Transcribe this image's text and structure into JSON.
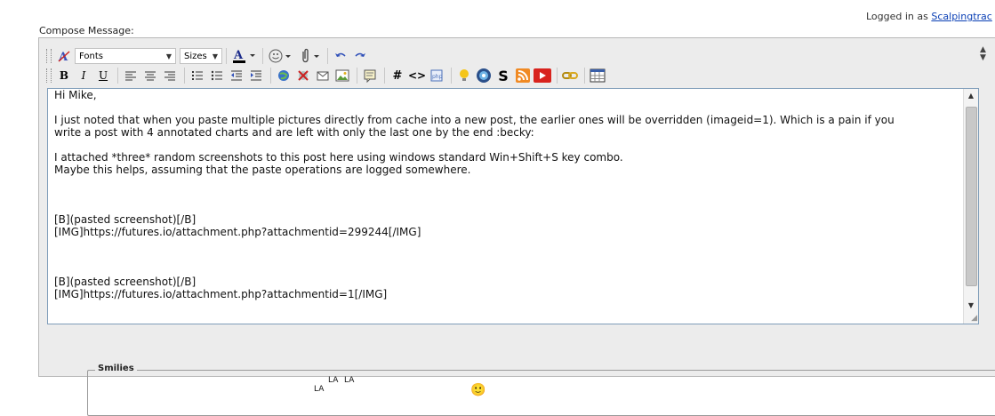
{
  "header": {
    "logged_in_prefix": "Logged in as",
    "username": "Scalpingtrac"
  },
  "compose": {
    "label": "Compose Message:"
  },
  "toolbar": {
    "font_select": "Fonts",
    "size_select": "Sizes",
    "bold": "B",
    "italic": "I",
    "underline": "U"
  },
  "editor": {
    "lines": [
      "Hi Mike,",
      "",
      "I just noted that when you paste multiple pictures directly from cache into a new post, the earlier ones will be overridden (imageid=1). Which is a pain if you",
      "write a post with 4 annotated charts and are left with only the last one by the end :becky:",
      "",
      "I attached *three* random screenshots to this post here using windows standard Win+Shift+S key combo.",
      "Maybe this helps, assuming that the paste operations are logged somewhere.",
      "",
      "",
      "",
      "[B](pasted screenshot)[/B]",
      "[IMG]https://futures.io/attachment.php?attachmentid=299244[/IMG]",
      "",
      "",
      "",
      "[B](pasted screenshot)[/B]",
      "[IMG]https://futures.io/attachment.php?attachmentid=1[/IMG]"
    ]
  },
  "smilies": {
    "label": "Smilies",
    "lala_text": "LA"
  },
  "colors": {
    "panel_bg": "#ececec",
    "editor_border": "#7f9db9",
    "link": "#0a3fb5",
    "spell_underline": "#e04040"
  }
}
